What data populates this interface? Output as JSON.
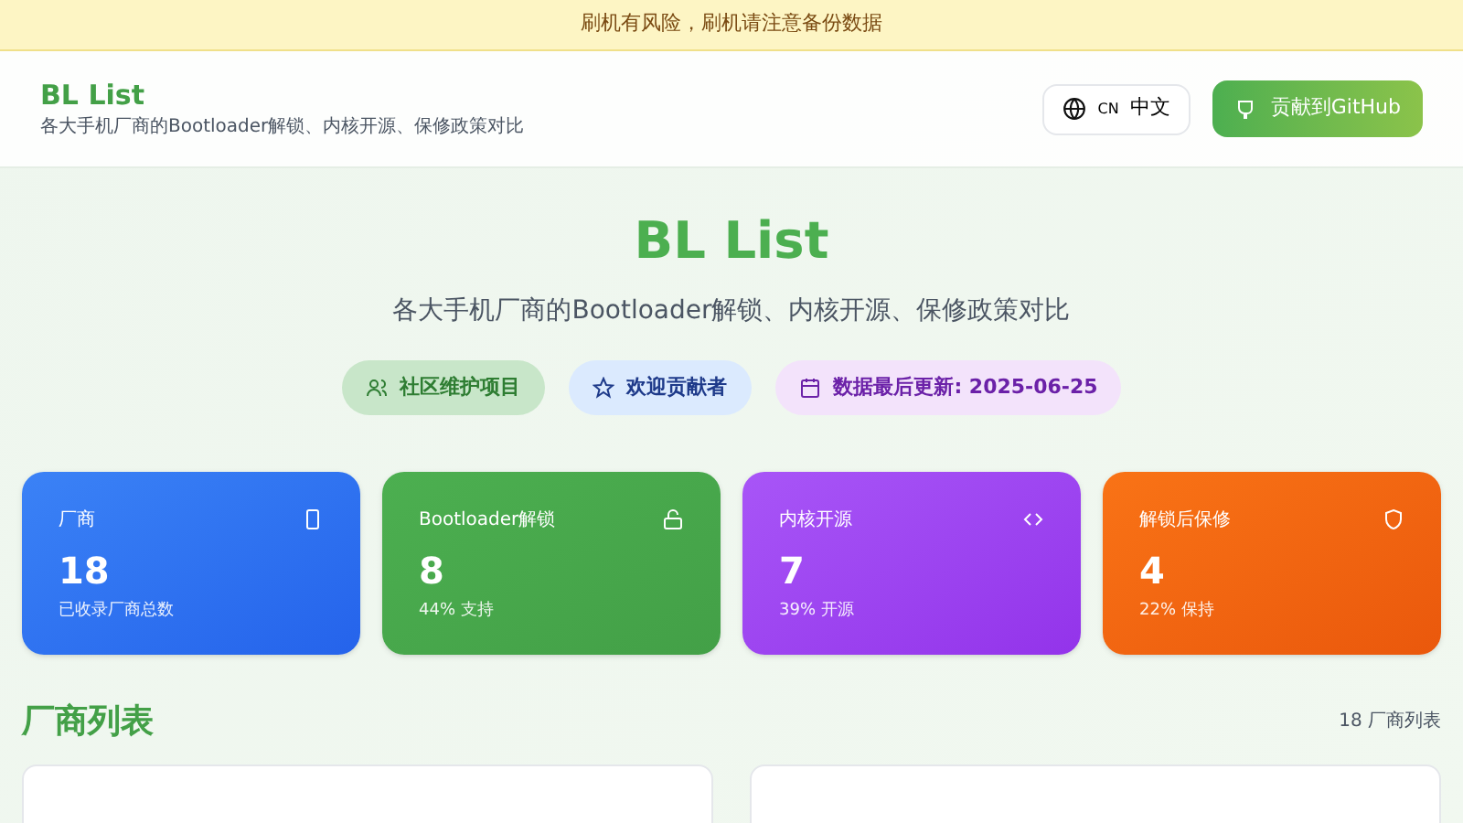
{
  "banner": {
    "text": "刷机有风险，刷机请注意备份数据"
  },
  "header": {
    "title": "BL List",
    "subtitle": "各大手机厂商的Bootloader解锁、内核开源、保修政策对比",
    "language": {
      "code": "CN",
      "label": "中文"
    },
    "github_button": "贡献到GitHub"
  },
  "hero": {
    "title": "BL List",
    "subtitle": "各大手机厂商的Bootloader解锁、内核开源、保修政策对比",
    "badges": [
      {
        "kind": "community",
        "label": "社区维护项目"
      },
      {
        "kind": "contributors",
        "label": "欢迎贡献者"
      },
      {
        "kind": "updated",
        "label": "数据最后更新: 2025-06-25"
      }
    ]
  },
  "stats": [
    {
      "kind": "phone",
      "label": "厂商",
      "value": "18",
      "note": "已收录厂商总数"
    },
    {
      "kind": "unlock",
      "label": "Bootloader解锁",
      "value": "8",
      "note": "44% 支持"
    },
    {
      "kind": "code",
      "label": "内核开源",
      "value": "7",
      "note": "39% 开源"
    },
    {
      "kind": "shield",
      "label": "解锁后保修",
      "value": "4",
      "note": "22% 保持"
    }
  ],
  "vendor_list": {
    "title": "厂商列表",
    "count": "18 厂商列表"
  }
}
